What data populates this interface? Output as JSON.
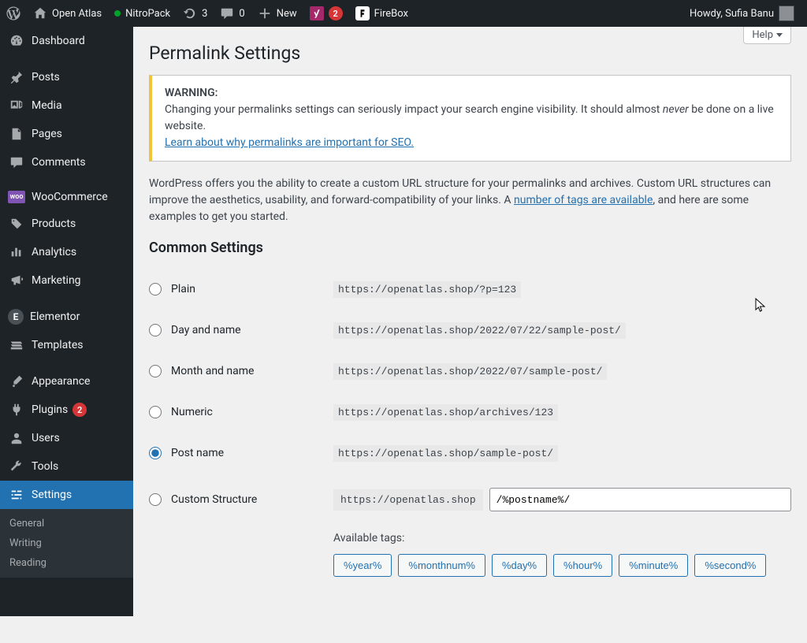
{
  "adminbar": {
    "site_name": "Open Atlas",
    "nitropack": "NitroPack",
    "update_count": "3",
    "comment_count": "0",
    "new_label": "New",
    "yoast_count": "2",
    "firebox_label": "FireBox",
    "howdy_prefix": "Howdy, ",
    "user_name": "Sufia Banu"
  },
  "sidebar": {
    "dashboard": "Dashboard",
    "posts": "Posts",
    "media": "Media",
    "pages": "Pages",
    "comments": "Comments",
    "woocommerce": "WooCommerce",
    "products": "Products",
    "analytics": "Analytics",
    "marketing": "Marketing",
    "elementor": "Elementor",
    "templates": "Templates",
    "appearance": "Appearance",
    "plugins": "Plugins",
    "plugins_badge": "2",
    "users": "Users",
    "tools": "Tools",
    "settings": "Settings",
    "sub_general": "General",
    "sub_writing": "Writing",
    "sub_reading": "Reading"
  },
  "page": {
    "help": "Help",
    "title": "Permalink Settings",
    "warning_label": "WARNING:",
    "warning_text_1": "Changing your permalinks settings can seriously impact your search engine visibility. It should almost ",
    "warning_never": "never",
    "warning_text_2": " be done on a live website.",
    "warning_link": "Learn about why permalinks are important for SEO.",
    "intro_1": "WordPress offers you the ability to create a custom URL structure for your permalinks and archives. Custom URL structures can improve the aesthetics, usability, and forward-compatibility of your links. A ",
    "intro_link": "number of tags are available",
    "intro_2": ", and here are some examples to get you started.",
    "common_settings": "Common Settings",
    "options": {
      "plain": {
        "label": "Plain",
        "example": "https://openatlas.shop/?p=123"
      },
      "dayname": {
        "label": "Day and name",
        "example": "https://openatlas.shop/2022/07/22/sample-post/"
      },
      "monthname": {
        "label": "Month and name",
        "example": "https://openatlas.shop/2022/07/sample-post/"
      },
      "numeric": {
        "label": "Numeric",
        "example": "https://openatlas.shop/archives/123"
      },
      "postname": {
        "label": "Post name",
        "example": "https://openatlas.shop/sample-post/"
      },
      "custom": {
        "label": "Custom Structure",
        "prefix": "https://openatlas.shop",
        "value": "/%postname%/"
      }
    },
    "available_tags_label": "Available tags:",
    "tags": [
      "%year%",
      "%monthnum%",
      "%day%",
      "%hour%",
      "%minute%",
      "%second%"
    ]
  }
}
